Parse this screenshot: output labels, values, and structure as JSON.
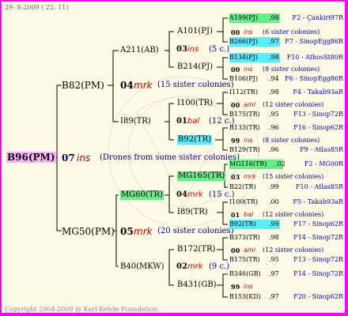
{
  "header": "29-  8-2009 ( 22: 11)",
  "footer": "Copyright 2004-2009 @ Karl Kehde Foundation.",
  "colors": {
    "green_box": "#66ee88",
    "cyan_box": "#55eeff",
    "pink_box": "#ffb0ff",
    "blue": "#0000aa",
    "red": "#cc0000",
    "line": "#000000"
  },
  "root": {
    "label": "B96(PM)",
    "num": "07",
    "ins": "ins",
    "note": "(Drones from some sister colonies)"
  },
  "B82": {
    "label": "B82(PM)",
    "num": "04",
    "ins": "mrk",
    "note": "(15 sister colonies)"
  },
  "MG50": {
    "label": "MG50(PM)",
    "num": "05",
    "ins": "mrk",
    "note": "(20 sister colonies)"
  },
  "A211": {
    "label": "A211(AB)"
  },
  "I89": {
    "label": "I89(TR)"
  },
  "MG60": {
    "label": "MG60(TR)"
  },
  "B40": {
    "label": "B40(MKW)"
  },
  "A101": {
    "label": "A101(PJ)",
    "num": "03",
    "ins": "ins",
    "note": "(5 c.)"
  },
  "B214": {
    "label": "B214(PJ)"
  },
  "I100": {
    "label": "I100(TR)",
    "num": "01",
    "ins": "bal",
    "note": "(12 c.)"
  },
  "B92": {
    "label": "B92(TR)"
  },
  "MG165": {
    "label": "MG165(TR)",
    "num": "04",
    "ins": "mrk",
    "note": "(15 c.)"
  },
  "I89b": {
    "label": "I89(TR)"
  },
  "B172": {
    "label": "B172(TR)",
    "num": "02",
    "ins": "mrk",
    "note": "(9 c.)"
  },
  "B431": {
    "label": "B431(GB)"
  },
  "right": [
    {
      "label": "A199(PJ)",
      "val": ".98",
      "src": "F2 - Çankiri97R"
    },
    {
      "num": "00",
      "ins": "ins",
      "note": "(6 sister colonies)"
    },
    {
      "label": "B266(PJ)",
      "val": ".97",
      "src": "F7 - SinopEgg86R"
    },
    {
      "label": "B134(PJ)",
      "val": ".98",
      "src": "F10 - AthosSt80R"
    },
    {
      "num": "00",
      "ins": "ins",
      "note": "(8 sister colonies)"
    },
    {
      "label": "B106(PJ)",
      "val": ".94",
      "src": "F6 - SinopEgg86R"
    },
    {
      "label": "I112(TR)",
      "val": ".98",
      "src": "F4 - Takab93aR"
    },
    {
      "num": "00",
      "ins": "aml",
      "note": "(12 sister colonies)"
    },
    {
      "label": "B175(TR)",
      "val": ".95",
      "src": "F13 - Sinop72R"
    },
    {
      "label": "B133(TR)",
      "val": ".96",
      "src": "F16 - Sinop62R"
    },
    {
      "num": "99",
      "ins": "ins",
      "note": "(8 sister colonies)"
    },
    {
      "label": "B129(TR)",
      "val": ".96",
      "src": "F9 - Atlas85R"
    },
    {
      "label": "MG116(TR)",
      "val": ".02",
      "src": "F2 - MG00R"
    },
    {
      "num": "03",
      "ins": "mrk",
      "note": "(15 sister colonies)"
    },
    {
      "label": "B22(TR)",
      "val": ".99",
      "src": "F10 - Atlas85R"
    },
    {
      "label": "I100(TR)",
      "val": ".00",
      "src": "F5 - Takab93aR"
    },
    {
      "num": "01",
      "ins": "bal",
      "note": "(12 sister colonies)"
    },
    {
      "label": "B92(TR)",
      "val": ".99",
      "src": "F17 - Sinop62R"
    },
    {
      "label": "B373(TR)",
      "val": ".98",
      "src": "F14 - Sinop72R"
    },
    {
      "num": "00",
      "ins": "aml",
      "note": "(12 sister colonies)"
    },
    {
      "label": "B175(TR)",
      "val": ".95",
      "src": "F13 - Sinop72R"
    },
    {
      "label": "B346(GB)",
      "val": ".97",
      "src": "F14 - Sinop72R"
    },
    {
      "num": "99",
      "ins": "ins",
      "note": ""
    },
    {
      "label": "B153(KD)",
      "val": ".97",
      "src": "F20 - Sinop62R"
    }
  ]
}
